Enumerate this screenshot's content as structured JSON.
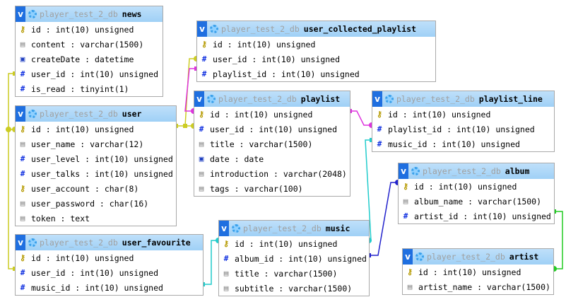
{
  "db_name": "player_test_2_db",
  "collapse_label": "v",
  "tables": [
    {
      "id": "news",
      "name": "news",
      "cols": [
        {
          "text": "id : int(10) unsigned",
          "icon": "key"
        },
        {
          "text": "content : varchar(1500)",
          "icon": "doc"
        },
        {
          "text": "createDate : datetime",
          "icon": "cal"
        },
        {
          "text": "user_id : int(10) unsigned",
          "icon": "hash"
        },
        {
          "text": "is_read : tinyint(1)",
          "icon": "hash"
        }
      ]
    },
    {
      "id": "ucp",
      "name": "user_collected_playlist",
      "cols": [
        {
          "text": "id : int(10) unsigned",
          "icon": "key"
        },
        {
          "text": "user_id : int(10) unsigned",
          "icon": "hash"
        },
        {
          "text": "playlist_id : int(10) unsigned",
          "icon": "hash"
        }
      ]
    },
    {
      "id": "user",
      "name": "user",
      "cols": [
        {
          "text": "id : int(10) unsigned",
          "icon": "key"
        },
        {
          "text": "user_name : varchar(12)",
          "icon": "doc"
        },
        {
          "text": "user_level : int(10) unsigned",
          "icon": "hash"
        },
        {
          "text": "user_talks : int(10) unsigned",
          "icon": "hash"
        },
        {
          "text": "user_account : char(8)",
          "icon": "key"
        },
        {
          "text": "user_password : char(16)",
          "icon": "doc"
        },
        {
          "text": "token : text",
          "icon": "doc"
        }
      ]
    },
    {
      "id": "playlist",
      "name": "playlist",
      "cols": [
        {
          "text": "id : int(10) unsigned",
          "icon": "key"
        },
        {
          "text": "user_id : int(10) unsigned",
          "icon": "hash"
        },
        {
          "text": "title : varchar(1500)",
          "icon": "doc"
        },
        {
          "text": "date : date",
          "icon": "cal"
        },
        {
          "text": "introduction : varchar(2048)",
          "icon": "doc"
        },
        {
          "text": "tags : varchar(100)",
          "icon": "doc"
        }
      ]
    },
    {
      "id": "pl_line",
      "name": "playlist_line",
      "cols": [
        {
          "text": "id : int(10) unsigned",
          "icon": "key"
        },
        {
          "text": "playlist_id : int(10) unsigned",
          "icon": "hash"
        },
        {
          "text": "music_id : int(10) unsigned",
          "icon": "hash"
        }
      ]
    },
    {
      "id": "album",
      "name": "album",
      "cols": [
        {
          "text": "id : int(10) unsigned",
          "icon": "key"
        },
        {
          "text": "album_name : varchar(1500)",
          "icon": "doc"
        },
        {
          "text": "artist_id : int(10) unsigned",
          "icon": "hash"
        }
      ]
    },
    {
      "id": "ufav",
      "name": "user_favourite",
      "cols": [
        {
          "text": "id : int(10) unsigned",
          "icon": "key"
        },
        {
          "text": "user_id : int(10) unsigned",
          "icon": "hash"
        },
        {
          "text": "music_id : int(10) unsigned",
          "icon": "hash"
        }
      ]
    },
    {
      "id": "music",
      "name": "music",
      "cols": [
        {
          "text": "id : int(10) unsigned",
          "icon": "key"
        },
        {
          "text": "album_id : int(10) unsigned",
          "icon": "hash"
        },
        {
          "text": "title : varchar(1500)",
          "icon": "doc"
        },
        {
          "text": "subtitle : varchar(1500)",
          "icon": "doc"
        }
      ]
    },
    {
      "id": "artist",
      "name": "artist",
      "cols": [
        {
          "text": "id : int(10) unsigned",
          "icon": "key"
        },
        {
          "text": "artist_name : varchar(1500)",
          "icon": "doc"
        }
      ]
    }
  ],
  "icons": {
    "key": "primary-key-icon",
    "hash": "numeric-column-icon",
    "doc": "text-column-icon",
    "cal": "date-column-icon"
  },
  "relation_colors": {
    "user": "#cccc22",
    "playlist": "#dd33dd",
    "music": "#22cccc",
    "album": "#2222cc",
    "artist": "#22cc22"
  }
}
